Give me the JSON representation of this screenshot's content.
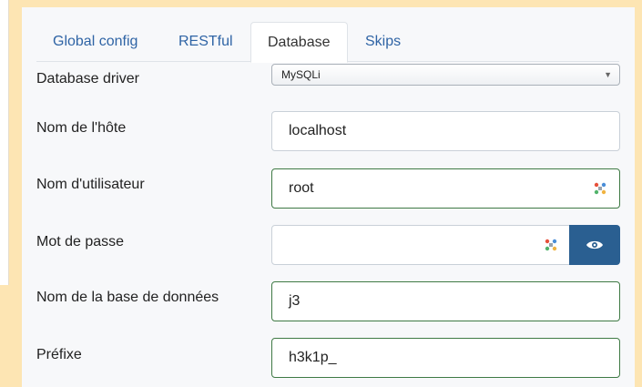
{
  "tabs": [
    {
      "label": "Global config"
    },
    {
      "label": "RESTful"
    },
    {
      "label": "Database"
    },
    {
      "label": "Skips"
    }
  ],
  "form": {
    "driver": {
      "label": "Database driver",
      "value": "MySQLi"
    },
    "host": {
      "label": "Nom de l'hôte",
      "value": "localhost"
    },
    "user": {
      "label": "Nom d'utilisateur",
      "value": "root"
    },
    "password": {
      "label": "Mot de passe",
      "value": ""
    },
    "database": {
      "label": "Nom de la base de données",
      "value": "j3"
    },
    "prefix": {
      "label": "Préfixe",
      "value": "h3k1p_"
    }
  },
  "icons": {
    "password_manager": "password-manager-icon",
    "toggle_visibility": "eye-icon"
  },
  "colors": {
    "accent_blue": "#2f64a5",
    "button_blue": "#2a5f91",
    "valid_green": "#3f7a45",
    "background": "#fde5b3"
  }
}
